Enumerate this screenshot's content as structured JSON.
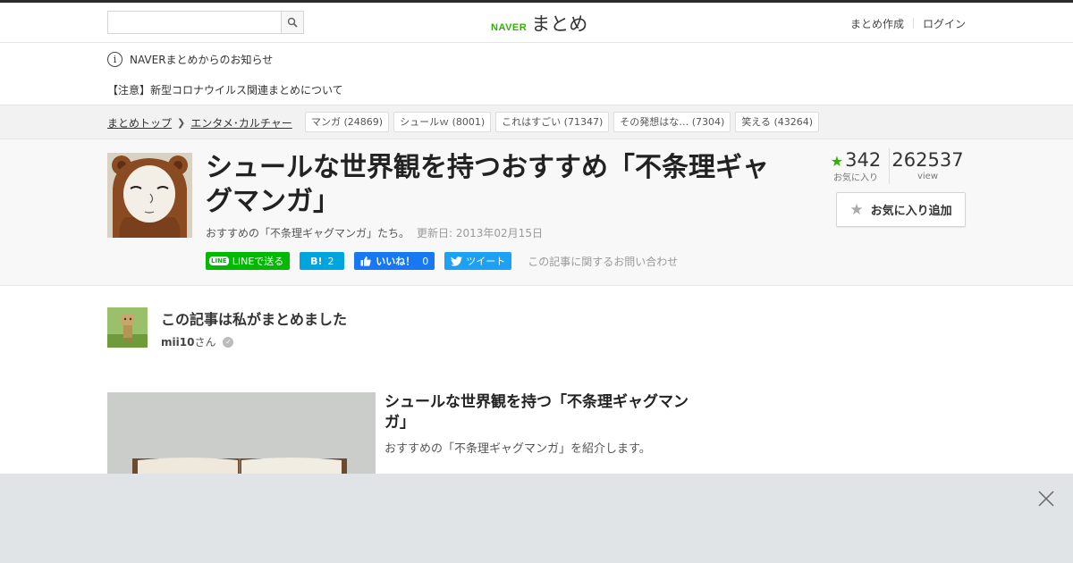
{
  "header": {
    "search_placeholder": "",
    "logo_brand": "NAVER",
    "logo_name": "まとめ",
    "links": [
      "まとめ作成",
      "ログイン"
    ]
  },
  "notice": {
    "heading": "NAVERまとめからのお知らせ",
    "link": "【注意】新型コロナウイルス関連まとめについて"
  },
  "breadcrumb": {
    "items": [
      "まとめトップ",
      "エンタメ･カルチャー"
    ],
    "tags": [
      {
        "label": "マンガ",
        "count": "(24869)"
      },
      {
        "label": "シュールｗ",
        "count": "(8001)"
      },
      {
        "label": "これはすごい",
        "count": "(71347)"
      },
      {
        "label": "その発想はな…",
        "count": "(7304)"
      },
      {
        "label": "笑える",
        "count": "(43264)"
      }
    ]
  },
  "article": {
    "title": "シュールな世界観を持つおすすめ「不条理ギャグマンガ」",
    "description": "おすすめの「不条理ギャグマンガ」たち。",
    "updated": "更新日: 2013年02月15日",
    "share": {
      "line": "LINEで送る",
      "line_badge": "LINE",
      "hatena_label": "B!",
      "hatena_count": "2",
      "fb_label": "いいね！",
      "fb_count": "0",
      "tweet": "ツイート"
    },
    "inquiry": "この記事に関するお問い合わせ",
    "favorites": "342",
    "favorites_label": "お気に入り",
    "views": "262537",
    "views_label": "view",
    "fav_button": "お気に入り追加"
  },
  "author": {
    "heading": "この記事は私がまとめました",
    "name": "mii10",
    "suffix": "さん"
  },
  "item": {
    "title": "シュールな世界観を持つ「不条理ギャグマンガ」",
    "description": "おすすめの「不条理ギャグマンガ」を紹介します。"
  },
  "colors": {
    "naver_green": "#2db400",
    "line_green": "#00b900",
    "hatena_blue": "#00a4de",
    "facebook_blue": "#1877f2",
    "twitter_blue": "#1da1f2"
  }
}
